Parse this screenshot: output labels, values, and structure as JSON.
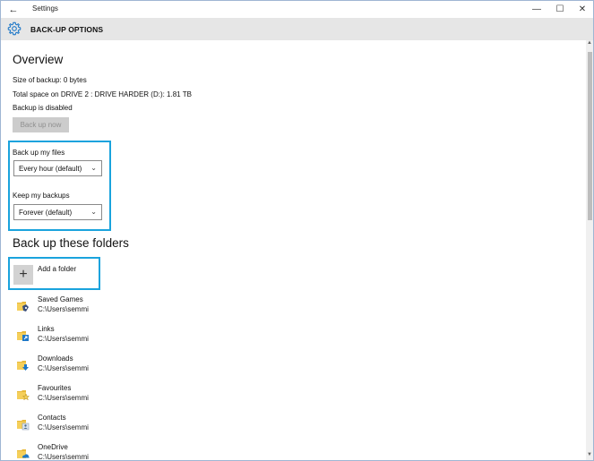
{
  "window": {
    "title": "Settings",
    "back_glyph": "←",
    "minimize_glyph": "—",
    "maximize_glyph": "☐",
    "close_glyph": "✕"
  },
  "header": {
    "icon": "gear-icon",
    "title": "BACK-UP OPTIONS"
  },
  "overview": {
    "heading": "Overview",
    "size_of_backup": "Size of backup: 0 bytes",
    "total_space": "Total space on DRIVE 2 : DRIVE HARDER (D:): 1.81 TB",
    "status": "Backup is disabled",
    "backup_now_label": "Back up now"
  },
  "settings": {
    "backup_files_label": "Back up my files",
    "backup_files_value": "Every hour (default)",
    "keep_backups_label": "Keep my backups",
    "keep_backups_value": "Forever (default)"
  },
  "folders": {
    "heading": "Back up these folders",
    "add_label": "Add a folder",
    "items": [
      {
        "name": "Saved Games",
        "path": "C:\\Users\\semmi",
        "icon": "saved-games-folder-icon"
      },
      {
        "name": "Links",
        "path": "C:\\Users\\semmi",
        "icon": "links-folder-icon"
      },
      {
        "name": "Downloads",
        "path": "C:\\Users\\semmi",
        "icon": "downloads-folder-icon"
      },
      {
        "name": "Favourites",
        "path": "C:\\Users\\semmi",
        "icon": "favourites-folder-icon"
      },
      {
        "name": "Contacts",
        "path": "C:\\Users\\semmi",
        "icon": "contacts-folder-icon"
      },
      {
        "name": "OneDrive",
        "path": "C:\\Users\\semmi",
        "icon": "onedrive-folder-icon"
      }
    ]
  },
  "colors": {
    "highlight": "#1aa3dd",
    "header_bg": "#e6e6e6",
    "folder_yellow": "#f2c94c",
    "accent_blue": "#1e78c8"
  }
}
